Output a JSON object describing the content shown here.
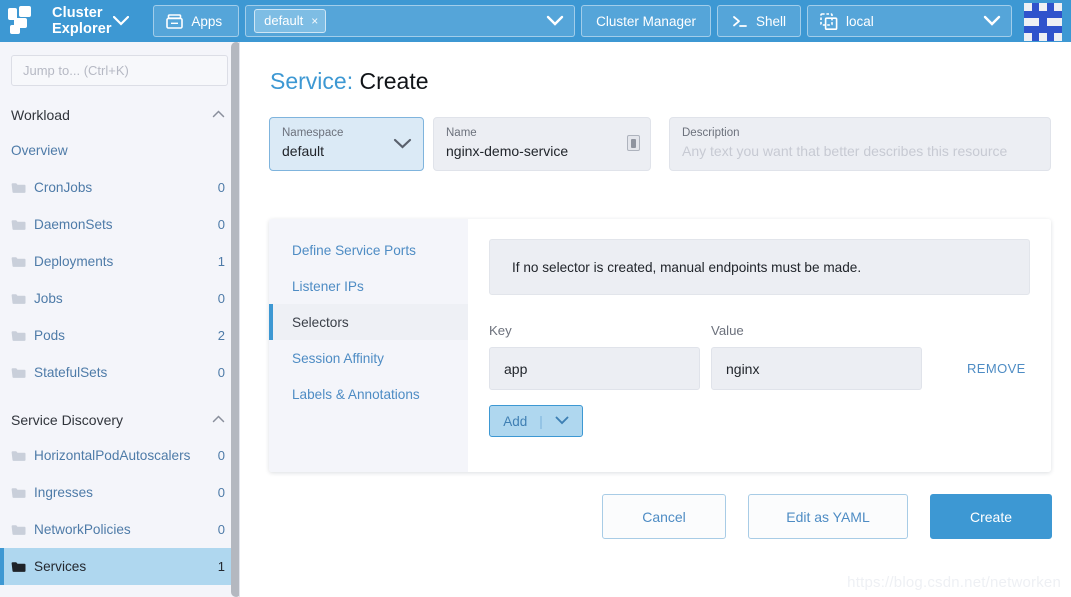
{
  "topbar": {
    "brand_title": "Cluster Explorer",
    "brand_caret": "⌄",
    "apps_label": "Apps",
    "namespace_chip": "default",
    "namespace_chip_close": "×",
    "namespace_caret": "⌄",
    "cluster_manager_label": "Cluster Manager",
    "shell_label": "Shell",
    "cluster_label": "local",
    "cluster_caret": "⌄",
    "avatar_colors": {
      "light": "#eef0f4",
      "dark": "#2f53cc"
    }
  },
  "sidebar": {
    "search_placeholder": "Jump to... (Ctrl+K)",
    "groups": [
      {
        "title": "Workload",
        "collapse_caret": "⌃",
        "items": [
          {
            "label": "Overview",
            "count": "",
            "has_folder": false
          },
          {
            "label": "CronJobs",
            "count": "0",
            "has_folder": true
          },
          {
            "label": "DaemonSets",
            "count": "0",
            "has_folder": true
          },
          {
            "label": "Deployments",
            "count": "1",
            "has_folder": true
          },
          {
            "label": "Jobs",
            "count": "0",
            "has_folder": true
          },
          {
            "label": "Pods",
            "count": "2",
            "has_folder": true
          },
          {
            "label": "StatefulSets",
            "count": "0",
            "has_folder": true
          }
        ]
      },
      {
        "title": "Service Discovery",
        "collapse_caret": "⌃",
        "items": [
          {
            "label": "HorizontalPodAutoscalers",
            "count": "0",
            "has_folder": true
          },
          {
            "label": "Ingresses",
            "count": "0",
            "has_folder": true
          },
          {
            "label": "NetworkPolicies",
            "count": "0",
            "has_folder": true
          },
          {
            "label": "Services",
            "count": "1",
            "has_folder": true,
            "active": true
          }
        ]
      }
    ]
  },
  "page": {
    "title_prefix": "Service:",
    "title_suffix": "Create",
    "namespace_label": "Namespace",
    "namespace_value": "default",
    "namespace_caret": "⌄",
    "name_label": "Name",
    "name_value": "nginx-demo-service",
    "description_label": "Description",
    "description_placeholder": "Any text you want that better describes this resource"
  },
  "card": {
    "tabs": [
      {
        "label": "Define Service Ports",
        "active": false
      },
      {
        "label": "Listener IPs",
        "active": false
      },
      {
        "label": "Selectors",
        "active": true
      },
      {
        "label": "Session Affinity",
        "active": false
      },
      {
        "label": "Labels & Annotations",
        "active": false
      }
    ],
    "banner_text": "If no selector is created, manual endpoints must be made.",
    "key_header": "Key",
    "value_header": "Value",
    "rows": [
      {
        "key": "app",
        "value": "nginx",
        "remove_label": "REMOVE"
      }
    ],
    "add_label": "Add",
    "add_separator": "|",
    "add_caret": "⌄"
  },
  "footer": {
    "cancel_label": "Cancel",
    "yaml_label": "Edit as YAML",
    "create_label": "Create"
  },
  "watermark": "https://blog.csdn.net/networken",
  "colors": {
    "accent": "#3d98d3",
    "link": "#4e8cc4",
    "sidebar_bg": "#f4f5fa",
    "field_bg": "#eceef3",
    "active_nav": "#afd7ef"
  }
}
